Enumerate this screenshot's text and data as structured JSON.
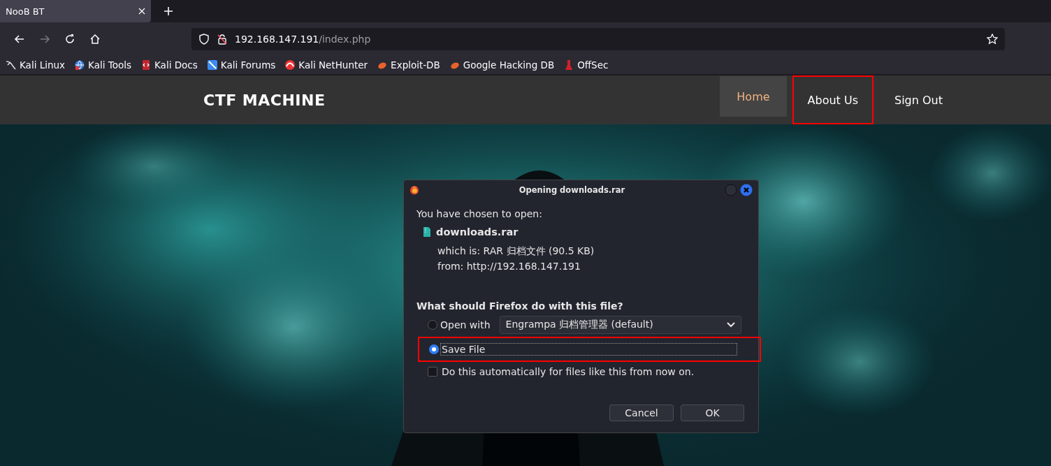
{
  "browser": {
    "tabs": [
      {
        "title": "NooB BT",
        "selected": true
      }
    ],
    "url": {
      "host": "192.168.147.191",
      "path": "/index.php"
    },
    "bookmarks": [
      {
        "label": "Kali Linux"
      },
      {
        "label": "Kali Tools"
      },
      {
        "label": "Kali Docs"
      },
      {
        "label": "Kali Forums"
      },
      {
        "label": "Kali NetHunter"
      },
      {
        "label": "Exploit-DB"
      },
      {
        "label": "Google Hacking DB"
      },
      {
        "label": "OffSec"
      }
    ]
  },
  "site": {
    "brand": "CTF MACHINE",
    "nav": [
      {
        "label": "Home",
        "selected": true,
        "highlighted": false
      },
      {
        "label": "About Us",
        "selected": false,
        "highlighted": true
      },
      {
        "label": "Sign Out",
        "selected": false,
        "highlighted": false
      }
    ]
  },
  "dialog": {
    "title": "Opening downloads.rar",
    "intro": "You have chosen to open:",
    "file": {
      "name": "downloads.rar",
      "type_label": "which is:",
      "type": "RAR 归档文件 (90.5 KB)",
      "from_label": "from:",
      "from": "http://192.168.147.191"
    },
    "question": "What should Firefox do with this file?",
    "options": [
      {
        "kind": "open",
        "label": "Open with",
        "selected": false,
        "highlighted": false,
        "focused": false,
        "app": "Engrampa 归档管理器 (default)"
      },
      {
        "kind": "save",
        "label": "Save File",
        "selected": true,
        "highlighted": true,
        "focused": true
      }
    ],
    "remember": {
      "label": "Do this automatically for files like this from now on.",
      "checked": false
    },
    "buttons": [
      {
        "label": "Cancel"
      },
      {
        "label": "OK"
      }
    ]
  }
}
